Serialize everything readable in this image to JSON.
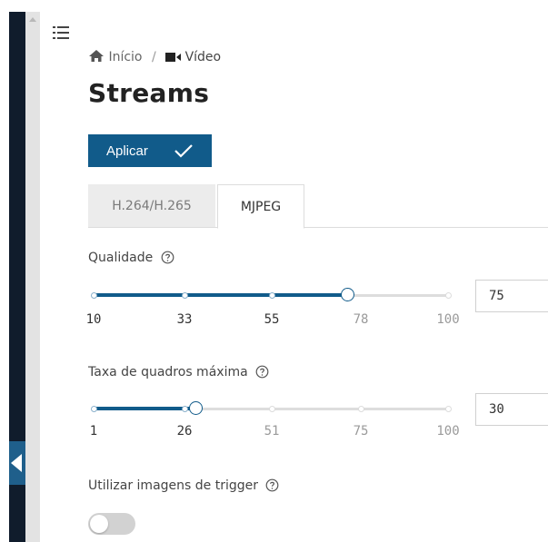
{
  "breadcrumb": {
    "home_label": "Início",
    "separator": "/",
    "current_label": "Vídeo"
  },
  "page": {
    "title": "Streams"
  },
  "toolbar": {
    "apply_label": "Aplicar"
  },
  "tabs": [
    {
      "label": "H.264/H.265",
      "active": false
    },
    {
      "label": "MJPEG",
      "active": true
    }
  ],
  "quality": {
    "label": "Qualidade",
    "ticks": [
      "10",
      "33",
      "55",
      "78",
      "100"
    ],
    "value": "75",
    "slider_value": 75,
    "slider_min": 10,
    "slider_max": 100
  },
  "max_frame_rate": {
    "label": "Taxa de quadros máxima",
    "ticks": [
      "1",
      "26",
      "51",
      "75",
      "100"
    ],
    "value": "30",
    "slider_value": 30,
    "slider_min": 1,
    "slider_max": 100
  },
  "trigger_images": {
    "label": "Utilizar imagens de trigger",
    "enabled": false
  },
  "colors": {
    "accent": "#115b8a",
    "sidebar_dark": "#101c2c",
    "collapse_tab": "#1f5f8b"
  },
  "icons": {
    "menu": "list-menu-icon",
    "home": "home-icon",
    "video": "video-camera-icon",
    "check": "check-icon",
    "help": "help-circle-icon",
    "collapse": "chevron-left-icon"
  }
}
